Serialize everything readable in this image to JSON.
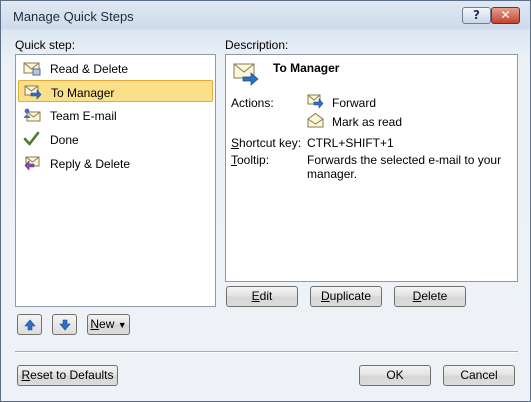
{
  "window": {
    "title": "Manage Quick Steps",
    "help_glyph": "?",
    "close_glyph": "✕"
  },
  "quick_step_label": "Quick step:",
  "quick_steps": [
    {
      "label": "Read & Delete",
      "icon": "envelope-delete-icon",
      "selected": false
    },
    {
      "label": "To Manager",
      "icon": "envelope-forward-icon",
      "selected": true
    },
    {
      "label": "Team E-mail",
      "icon": "team-email-icon",
      "selected": false
    },
    {
      "label": "Done",
      "icon": "checkmark-icon",
      "selected": false
    },
    {
      "label": "Reply & Delete",
      "icon": "envelope-reply-icon",
      "selected": false
    }
  ],
  "description": {
    "label": "Description:",
    "title": "To Manager",
    "actions_label": "Actions:",
    "actions": [
      {
        "label": "Forward",
        "icon": "forward-arrow-icon"
      },
      {
        "label": "Mark as read",
        "icon": "open-envelope-icon"
      }
    ],
    "shortcut_label": "Shortcut key:",
    "shortcut_value": "CTRL+SHIFT+1",
    "tooltip_label": "Tooltip:",
    "tooltip_value": "Forwards the selected e-mail to your manager."
  },
  "buttons": {
    "edit": "Edit",
    "duplicate": "Duplicate",
    "delete": "Delete",
    "new": "New",
    "reset": "Reset to Defaults",
    "ok": "OK",
    "cancel": "Cancel"
  },
  "colors": {
    "selection": "#fbe08a",
    "selection_border": "#e3a93a",
    "accent_blue": "#2f6fc7"
  }
}
